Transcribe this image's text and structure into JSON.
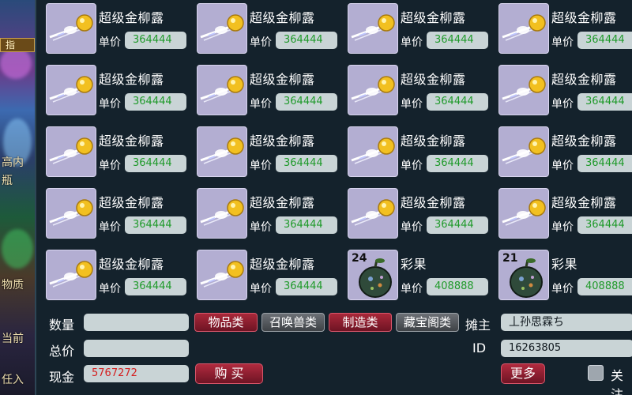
{
  "world": {
    "tab_label": "指",
    "side_texts": [
      "高内",
      "瓶",
      "物质",
      "当前",
      "任入"
    ]
  },
  "grid": [
    {
      "name": "超级金柳露",
      "price_label": "单价",
      "price": "364444",
      "icon": "golden-dew-bottle-icon",
      "count": ""
    },
    {
      "name": "超级金柳露",
      "price_label": "单价",
      "price": "364444",
      "icon": "golden-dew-bottle-icon",
      "count": ""
    },
    {
      "name": "超级金柳露",
      "price_label": "单价",
      "price": "364444",
      "icon": "golden-dew-bottle-icon",
      "count": ""
    },
    {
      "name": "超级金柳露",
      "price_label": "单价",
      "price": "364444",
      "icon": "golden-dew-bottle-icon",
      "count": ""
    },
    {
      "name": "超级金柳露",
      "price_label": "单价",
      "price": "364444",
      "icon": "golden-dew-bottle-icon",
      "count": ""
    },
    {
      "name": "超级金柳露",
      "price_label": "单价",
      "price": "364444",
      "icon": "golden-dew-bottle-icon",
      "count": ""
    },
    {
      "name": "超级金柳露",
      "price_label": "单价",
      "price": "364444",
      "icon": "golden-dew-bottle-icon",
      "count": ""
    },
    {
      "name": "超级金柳露",
      "price_label": "单价",
      "price": "364444",
      "icon": "golden-dew-bottle-icon",
      "count": ""
    },
    {
      "name": "超级金柳露",
      "price_label": "单价",
      "price": "364444",
      "icon": "golden-dew-bottle-icon",
      "count": ""
    },
    {
      "name": "超级金柳露",
      "price_label": "单价",
      "price": "364444",
      "icon": "golden-dew-bottle-icon",
      "count": ""
    },
    {
      "name": "超级金柳露",
      "price_label": "单价",
      "price": "364444",
      "icon": "golden-dew-bottle-icon",
      "count": ""
    },
    {
      "name": "超级金柳露",
      "price_label": "单价",
      "price": "364444",
      "icon": "golden-dew-bottle-icon",
      "count": ""
    },
    {
      "name": "超级金柳露",
      "price_label": "单价",
      "price": "364444",
      "icon": "golden-dew-bottle-icon",
      "count": ""
    },
    {
      "name": "超级金柳露",
      "price_label": "单价",
      "price": "364444",
      "icon": "golden-dew-bottle-icon",
      "count": ""
    },
    {
      "name": "超级金柳露",
      "price_label": "单价",
      "price": "364444",
      "icon": "golden-dew-bottle-icon",
      "count": ""
    },
    {
      "name": "超级金柳露",
      "price_label": "单价",
      "price": "364444",
      "icon": "golden-dew-bottle-icon",
      "count": ""
    },
    {
      "name": "超级金柳露",
      "price_label": "单价",
      "price": "364444",
      "icon": "golden-dew-bottle-icon",
      "count": ""
    },
    {
      "name": "超级金柳露",
      "price_label": "单价",
      "price": "364444",
      "icon": "golden-dew-bottle-icon",
      "count": ""
    },
    {
      "name": "彩果",
      "price_label": "单价",
      "price": "408888",
      "icon": "colorful-fruit-icon",
      "count": "24"
    },
    {
      "name": "彩果",
      "price_label": "单价",
      "price": "408888",
      "icon": "colorful-fruit-icon",
      "count": "21"
    }
  ],
  "controls": {
    "quantity_label": "数量",
    "quantity_value": "",
    "total_label": "总价",
    "total_value": "",
    "cash_label": "现金",
    "cash_value": "5767272",
    "buy_button": "购 买",
    "categories": [
      {
        "label": "物品类",
        "active": true
      },
      {
        "label": "召唤兽类",
        "active": false
      },
      {
        "label": "制造类",
        "active": true
      },
      {
        "label": "藏宝阁类",
        "active": false
      }
    ],
    "owner_label": "摊主",
    "owner_value": "丄孙思霖ち",
    "id_label": "ID",
    "id_value": "16263805",
    "more_button": "更多",
    "follow_label": "关注"
  },
  "colors": {
    "price_text": "#1f9a2a",
    "cash_text": "#d42020",
    "panel_bg": "#14222c",
    "thumb_bg": "#b3aed2"
  }
}
